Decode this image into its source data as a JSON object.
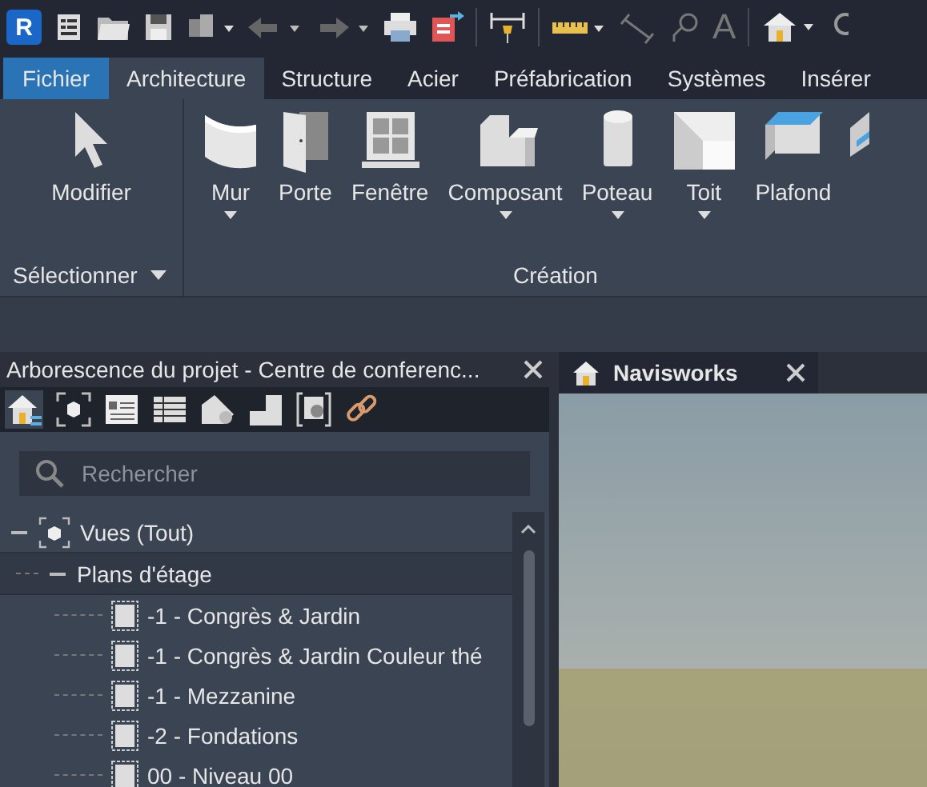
{
  "quick_access": {
    "logo": "R",
    "text_tool": "A"
  },
  "ribbon_tabs": [
    {
      "label": "Fichier",
      "kind": "file",
      "selected": false
    },
    {
      "label": "Architecture",
      "kind": "tab",
      "selected": true
    },
    {
      "label": "Structure",
      "kind": "tab",
      "selected": false
    },
    {
      "label": "Acier",
      "kind": "tab",
      "selected": false
    },
    {
      "label": "Préfabrication",
      "kind": "tab",
      "selected": false
    },
    {
      "label": "Systèmes",
      "kind": "tab",
      "selected": false
    },
    {
      "label": "Insérer",
      "kind": "tab",
      "selected": false
    }
  ],
  "ribbon_panels": [
    {
      "label": "Sélectionner",
      "dropdown": true,
      "buttons": [
        {
          "label": "Modifier",
          "kind": "select",
          "dropdown": false
        }
      ]
    },
    {
      "label": "Création",
      "dropdown": false,
      "buttons": [
        {
          "label": "Mur",
          "kind": "wall",
          "dropdown": true
        },
        {
          "label": "Porte",
          "kind": "door",
          "dropdown": false
        },
        {
          "label": "Fenêtre",
          "kind": "window",
          "dropdown": false
        },
        {
          "label": "Composant",
          "kind": "component",
          "dropdown": true
        },
        {
          "label": "Poteau",
          "kind": "column",
          "dropdown": true
        },
        {
          "label": "Toit",
          "kind": "roof",
          "dropdown": true
        },
        {
          "label": "Plafond",
          "kind": "ceiling",
          "dropdown": false
        },
        {
          "kind": "floor",
          "dropdown": false
        }
      ]
    }
  ],
  "project_browser": {
    "title": "Arborescence du projet - Centre de conferenc...",
    "search": {
      "placeholder": "Rechercher"
    },
    "tree": [
      {
        "label": "Vues (Tout)",
        "expanded": true,
        "selected": false,
        "children": [
          {
            "label": "Plans d'étage",
            "expanded": true,
            "selected": true,
            "children": [
              {
                "label": "-1 - Congrès & Jardin",
                "selected": false
              },
              {
                "label": "-1 - Congrès & Jardin Couleur thé",
                "selected": false
              },
              {
                "label": "-1 - Mezzanine",
                "selected": false
              },
              {
                "label": "-2 - Fondations",
                "selected": false
              },
              {
                "label": "00 - Niveau 00",
                "selected": false
              }
            ]
          }
        ]
      }
    ]
  },
  "view_tabs": [
    {
      "label": "Navisworks",
      "selected": true
    }
  ]
}
